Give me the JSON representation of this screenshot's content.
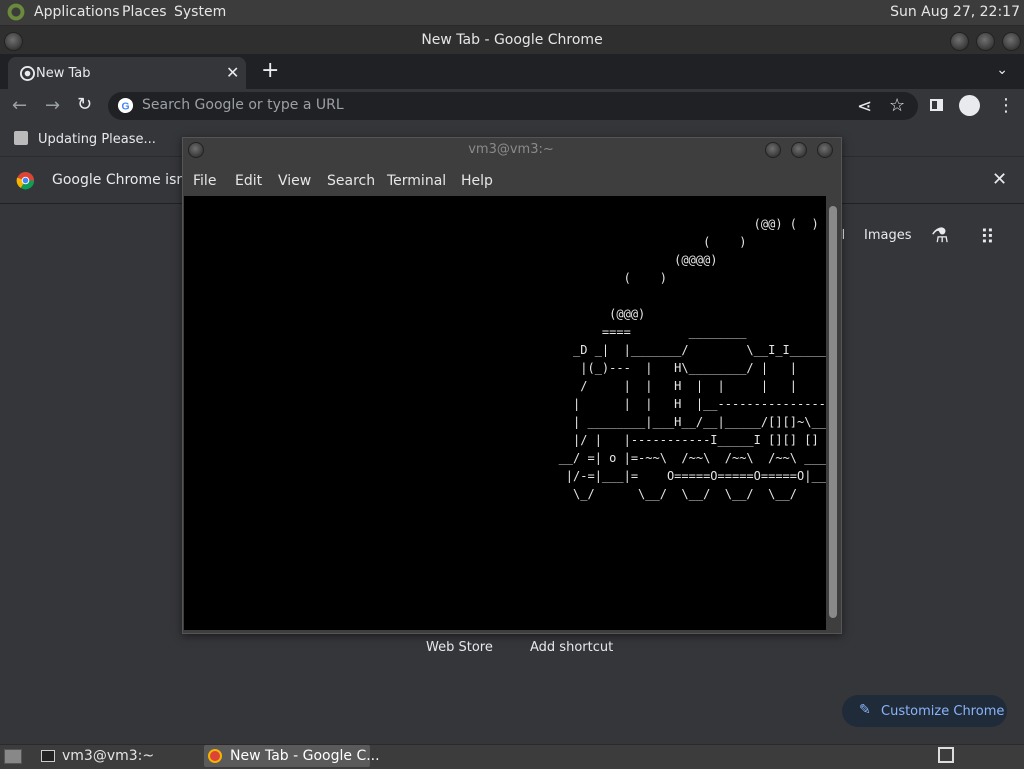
{
  "panel": {
    "menus": [
      "Applications",
      "Places",
      "System"
    ],
    "clock": "Sun Aug 27, 22:17"
  },
  "chrome": {
    "window_title": "New Tab - Google Chrome",
    "tab_title": "New Tab",
    "omnibox_placeholder": "Search Google or type a URL",
    "bookmark": "Updating Please...",
    "infobar_text": "Google Chrome isn't y",
    "ntp": {
      "gmail_partial": "il",
      "images": "Images",
      "shortcuts": [
        "Web Store",
        "Add shortcut"
      ],
      "customize": "Customize Chrome"
    }
  },
  "terminal": {
    "title": "vm3@vm3:~",
    "menus": [
      "File",
      "Edit",
      "View",
      "Search",
      "Terminal",
      "Help"
    ],
    "screen_text": "                                                                                   (@@) (  ) (@)  ( )\n                                                                            (    )\n                                                                        (@@@@)\n                                                                 (    )\n\n                                                               (@@@)\n                                                              ====        ________\n                                                          _D _|  |_______/        \\__I_I_____==\n                                                           |(_)---  |   H\\________/ |   |\n                                                           /     |  |   H  |  |     |   |\n                                                          |      |  |   H  |__-----------------\n                                                          | ________|___H__/__|_____/[][]~\\____\n                                                          |/ |   |-----------I_____I [][] []  D\n                                                        __/ =| o |=-~~\\  /~~\\  /~~\\  /~~\\ ____Y\n                                                         |/-=|___|=    O=====O=====O=====O|_____\n                                                          \\_/      \\__/  \\__/  \\__/  \\__/"
  },
  "taskbar": {
    "items": [
      "vm3@vm3:~",
      "New Tab - Google C..."
    ]
  },
  "colors": {
    "chrome_bg": "#35363a",
    "tabstrip": "#202124",
    "accent": "#8ab4f8"
  }
}
